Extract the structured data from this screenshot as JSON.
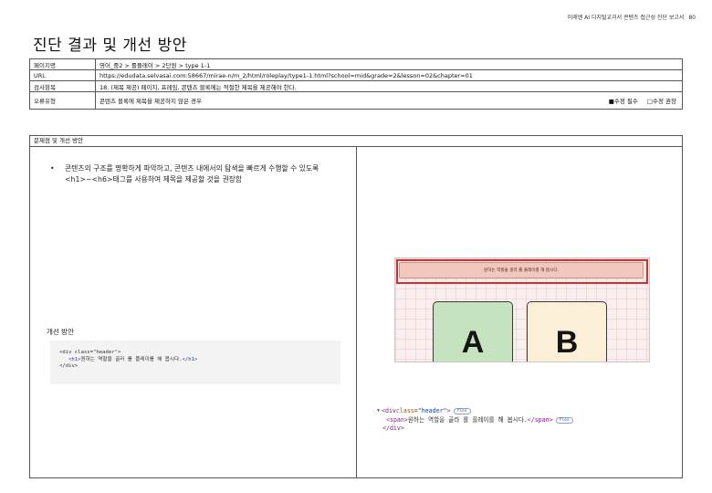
{
  "header": {
    "report_title": "미래엔 AI 디지털교과서 콘텐츠 접근성 진단 보고서",
    "page_number": "80"
  },
  "page_title": "진단 결과 및 개선 방안",
  "info": {
    "rows": [
      {
        "label": "페이지명",
        "value": "영어_중2 > 롤플레이 > 2단원 > type 1-1"
      },
      {
        "label": "URL",
        "value": "https://edudata.selvasai.com:58667/mirae-n/m_2/html/roleplay/type1-1.html?school=mid&grade=2&lesson=02&chapter=01"
      },
      {
        "label": "검사항목",
        "value": "18. (제목 제공) 페이지, 프레임, 콘텐츠 블록에는 적절한 제목을 제공해야 한다."
      },
      {
        "label": "오류유형",
        "value": "콘텐츠 블록에 제목을 제공하지 않은 경우"
      }
    ],
    "check_required": "■수정 필수",
    "check_recommended": "□수정 권장"
  },
  "section": {
    "title": "문제점 및 개선 방안",
    "bullet": "콘텐츠의 구조를 명확하게 파악하고, 콘텐츠 내에서의 탐색을 빠르게 수행할 수 있도록 <h1>~<h6>태그를 사용하여 제목을 제공할 것을 권장함",
    "improve_title": "개선 방안",
    "code": {
      "open": "<div class=\"header\">",
      "h1_open": "<h1>",
      "h1_text": "원하는 역할을 골라 롤 플레이를 해 봅시다.",
      "h1_close": "</h1>",
      "close": "</div>"
    }
  },
  "preview": {
    "banner_text": "원하는 역할을 골라 롤 플레이를 해 봅시다.",
    "card_a": "A",
    "card_b": "B"
  },
  "devtools": {
    "tri": "▼",
    "div_open_a": "<div ",
    "attr_name": "class",
    "eq": "=",
    "attr_value": "\"header\"",
    "div_open_b": ">",
    "span_open": "<span>",
    "span_text": "원하는 역할을 골라 롤 플레이를 해 봅시다.",
    "span_close": "</span>",
    "div_close": "</div>",
    "badge": "flex"
  }
}
